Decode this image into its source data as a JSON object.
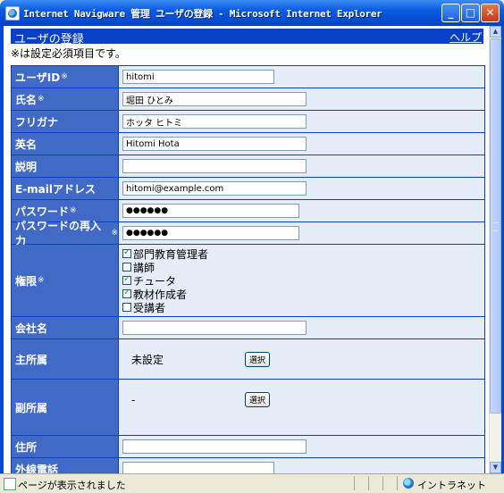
{
  "window": {
    "title": "Internet Navigware 管理 ユーザの登録 - Microsoft Internet Explorer",
    "controls": {
      "minimize": "_",
      "maximize": "□",
      "close": "✕"
    }
  },
  "header": {
    "title": "ユーザの登録",
    "help": "ヘルプ"
  },
  "required_note": "※は設定必須項目です。",
  "required_mark": "※",
  "fields": {
    "user_id": {
      "label": "ユーザID",
      "value": "hitomi"
    },
    "name": {
      "label": "氏名",
      "value": "堀田 ひとみ"
    },
    "furigana": {
      "label": "フリガナ",
      "value": "ホッタ ヒトミ"
    },
    "english_name": {
      "label": "英名",
      "value": "Hitomi Hota"
    },
    "description": {
      "label": "説明",
      "value": ""
    },
    "email": {
      "label": "E-mailアドレス",
      "value": "hitomi@example.com"
    },
    "password": {
      "label": "パスワード",
      "value": "●●●●●●"
    },
    "password_confirm": {
      "label": "パスワードの再入力",
      "value": "●●●●●●"
    },
    "permissions": {
      "label": "権限",
      "options": [
        {
          "label": "部門教育管理者",
          "checked": true
        },
        {
          "label": "講師",
          "checked": false
        },
        {
          "label": "チュータ",
          "checked": true
        },
        {
          "label": "教材作成者",
          "checked": true
        },
        {
          "label": "受講者",
          "checked": false
        }
      ]
    },
    "company": {
      "label": "会社名",
      "value": ""
    },
    "primary_affiliation": {
      "label": "主所属",
      "value": "未設定",
      "button": "選択"
    },
    "secondary_affiliation": {
      "label": "副所属",
      "value": "-",
      "button": "選択"
    },
    "address": {
      "label": "住所",
      "value": ""
    },
    "external_phone": {
      "label": "外線電話",
      "value": ""
    }
  },
  "statusbar": {
    "text": "ページが表示されました",
    "zone": "イントラネット"
  },
  "icons": {
    "app": "ie-icon",
    "status": "page-icon",
    "zone": "globe-icon"
  },
  "colors": {
    "header_band": "#0a40c8",
    "label_bg": "#4169c6",
    "cell_bg": "#e5edf9"
  }
}
